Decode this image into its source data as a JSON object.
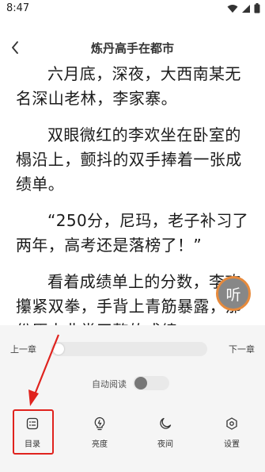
{
  "status_bar": {
    "time": "8:47",
    "icons": [
      "wifi-icon",
      "signal-icon",
      "battery-icon"
    ]
  },
  "header": {
    "back_icon": "chevron-left-icon",
    "title": "炼丹高手在都市"
  },
  "content": {
    "paragraphs": [
      "六月底，深夜，大西南某无名深山老林，李家寨。",
      "双眼微红的李欢坐在卧室的榻沿上，颤抖的双手捧着一张成绩单。",
      "“250分，尼玛，老子补习了两年，高考还是落榜了！”",
      "看着成绩单上的分数，李欢攥紧双拳，手背上青筋暴露，那份原本非常平整的成绩"
    ]
  },
  "listen_button": {
    "label": "听",
    "ring_color": "#e78a3c"
  },
  "panel": {
    "prev_chapter": "上一章",
    "next_chapter": "下一章",
    "progress": 0,
    "auto_read_label": "自动阅读",
    "auto_read_on": false
  },
  "nav": [
    {
      "label": "目录",
      "icon": "catalog-icon"
    },
    {
      "label": "亮度",
      "icon": "brightness-icon"
    },
    {
      "label": "夜间",
      "icon": "moon-icon"
    },
    {
      "label": "设置",
      "icon": "settings-icon"
    }
  ],
  "annotation": {
    "color": "#e0231e"
  }
}
